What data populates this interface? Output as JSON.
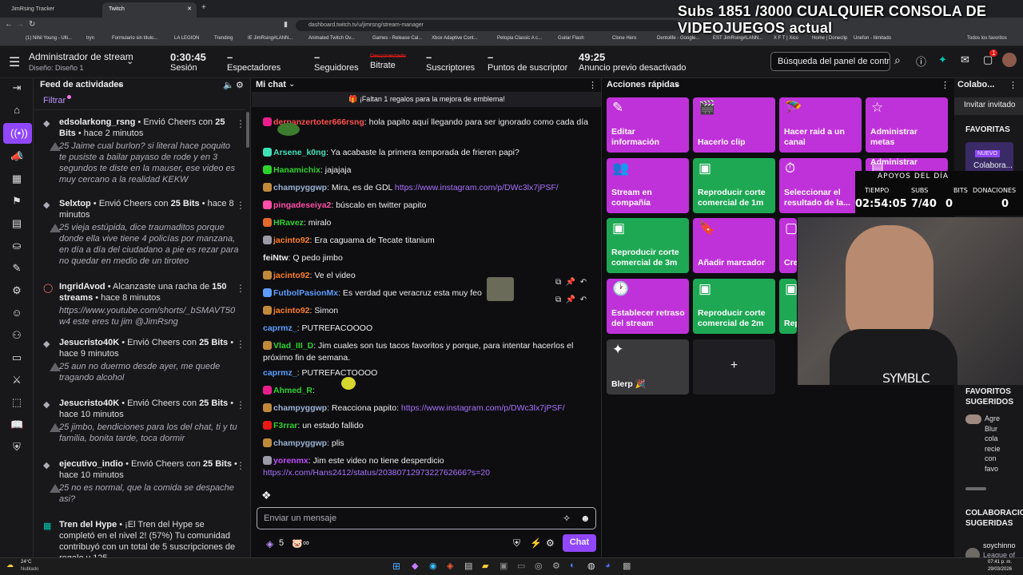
{
  "browser": {
    "tabs": [
      {
        "label": "JimRsing Tracker"
      },
      {
        "label": "Twitch"
      }
    ],
    "new_tab": "+",
    "url": "dashboard.twitch.tv/u/jimrsng/stream-manager",
    "bookmarks": [
      "(1) Nihil Young - Ulti...",
      "tryn",
      "Formulario sin titulo...",
      "LA LEGION",
      "Trending",
      "IE JimRsing#LANN...",
      "Animated Twitch Ov...",
      "Games - Release Cal...",
      "Xbox Adaptive Cont...",
      "Petopia Classic A c...",
      "Guitar Flash",
      "Clone Hero",
      "Dentolife - Google...",
      "EST JimRsing#LANN...",
      "X F T | Xico",
      "Home | Doneclip",
      "Unefon - Ilimitado",
      "Todos los favoritos"
    ]
  },
  "overlay": {
    "title_line1": "Subs 1851 /3000 CUALQUIER CONSOLA DE",
    "title_line2": "VIDEOJUEGOS actual",
    "apoyos_title": "APOYOS DEL DÍA",
    "headers": [
      "TIEMPO",
      "SUBS",
      "BITS",
      "DONACIONES"
    ],
    "values": [
      "02:54:05",
      "7/40",
      "0",
      "0"
    ],
    "logo_text": "SYMBLC"
  },
  "header": {
    "title": "Administrador de stream",
    "subtitle": "Diseño: Diseño 1",
    "session_time": "0:30:45",
    "session_label": "Sesión",
    "viewers_value": "–",
    "viewers_label": "Espectadores",
    "followers_value": "–",
    "followers_label": "Seguidores",
    "bitrate_value": "Desconectado",
    "bitrate_label": "Bitrate",
    "subs_value": "–",
    "subs_label": "Suscriptores",
    "points_value": "–",
    "points_label": "Puntos de suscriptor",
    "ad_time": "49:25",
    "ad_label": "Anuncio previo desactivado",
    "search_placeholder": "Búsqueda del panel de control",
    "notif_count": "1"
  },
  "feed": {
    "title": "Feed de actividades",
    "filter": "Filtrar",
    "items": [
      {
        "user": "edsolarkong_rsng",
        "text": " • Envió Cheers con ",
        "bits": "25 Bits",
        "time": " • hace 2 minutos",
        "msg": "25 Jaime cual burlon? si literal hace poquito te pusiste a bailar payaso de rode y en 3 segundos te diste en la mauser, ese video es muy cercano a la realidad KEKW"
      },
      {
        "user": "Selxtop",
        "text": " • Envió Cheers con ",
        "bits": "25 Bits",
        "time": " • hace 8 minutos",
        "msg": "25 vieja estúpida, dice traumaditos porque donde ella vive tiene 4 policías por manzana, en día a día del ciudadano a pie es rezar para no quedar en medio de un tiroteo"
      },
      {
        "user": "IngridAvod",
        "text": " • Alcanzaste una racha de ",
        "bits": "150 streams",
        "time": " • hace 8 minutos",
        "msg": "https://www.youtube.com/shorts/_bSMAVT50w4 este eres tu jim @JimRsng"
      },
      {
        "user": "Jesucristo40K",
        "text": " • Envió Cheers con ",
        "bits": "25 Bits",
        "time": " • hace 9 minutos",
        "msg": "25 aun no duermo desde ayer, me quede tragando alcohol"
      },
      {
        "user": "Jesucristo40K",
        "text": " • Envió Cheers con ",
        "bits": "25 Bits",
        "time": " • hace 10 minutos",
        "msg": "25 jimbo, bendiciones para los del chat, ti y tu familia, bonita tarde, toca dormir"
      },
      {
        "user": "ejecutivo_indio",
        "text": " • Envió Cheers con ",
        "bits": "25 Bits",
        "time": " • hace 10 minutos",
        "msg": "25 no es normal, que la comida se despache asi?"
      },
      {
        "user": "Tren del Hype",
        "text": " • ¡El Tren del Hype se completó en el nivel 2! (57%) Tu comunidad contribuyó con un total de 5 suscripciones de regalo y 125",
        "bits": "",
        "time": "",
        "msg": ""
      }
    ]
  },
  "chat": {
    "title": "Mi chat",
    "banner": "¡Faltan 1 regalos para la mejora de emblema!",
    "messages": [
      {
        "user": "derpanzertoter666rsng",
        "color": "#ff4f4f",
        "text": ": hola papito aquí llegando para ser ignorado como cada día"
      },
      {
        "user": "Arsene_k0ng",
        "color": "#3ee0b8",
        "text": ": Ya acabaste la primera temporada de frieren papi?"
      },
      {
        "user": "Hanamichix",
        "color": "#2ed12e",
        "text": ": jajajaja"
      },
      {
        "user": "champyggwp",
        "color": "#9bb3d6",
        "text": ": Mira, es de GDL ",
        "link": "https://www.instagram.com/p/DWc3lx7jPSF/"
      },
      {
        "user": "pingadeseiya2",
        "color": "#ff4fa8",
        "text": ": búscalo en twitter papito"
      },
      {
        "user": "HRavez",
        "color": "#2ed12e",
        "text": ": miralo"
      },
      {
        "user": "jacinto92",
        "color": "#ff7f27",
        "text": ": Era caguama de Tecate titanium"
      },
      {
        "user": "feiNtw",
        "color": "#efeff1",
        "text": ": Q pedo jimbo"
      },
      {
        "user": "jacinto92",
        "color": "#ff7f27",
        "text": ": Ve el video"
      },
      {
        "user": "FutbolPasionMx",
        "color": "#5c9eff",
        "text": ": Es verdad que veracruz esta muy feo"
      },
      {
        "user": "jacinto92",
        "color": "#ff7f27",
        "text": ": Simon"
      },
      {
        "user": "caprmz_",
        "color": "#5c9eff",
        "text": ": PUTREFACOOOO"
      },
      {
        "user": "Vlad_III_D",
        "color": "#2ed12e",
        "text": ": Jim cuales son tus tacos favoritos y porque, para intentar hacerlos el próximo fin de semana."
      },
      {
        "user": "caprmz_",
        "color": "#5c9eff",
        "text": ": PUTREFACTOOOO"
      },
      {
        "user": "Ahmed_R",
        "color": "#2ed12e",
        "text": ":"
      },
      {
        "user": "champyggwp",
        "color": "#9bb3d6",
        "text": ": Reacciona papito: ",
        "link": "https://www.instagram.com/p/DWc3lx7jPSF/"
      },
      {
        "user": "F3rrar",
        "color": "#2ed12e",
        "text": ": un estado fallido"
      },
      {
        "user": "champyggwp",
        "color": "#9bb3d6",
        "text": ": plis"
      },
      {
        "user": "yorenmx",
        "color": "#c04bff",
        "text": ": Jim este video no tiene desperdicio",
        "link": "https://x.com/Hans2412/status/2038071297322762666?s=20"
      }
    ],
    "input_placeholder": "Enviar un mensaje",
    "points": "5",
    "infinity": "∞",
    "chat_button": "Chat"
  },
  "quick_actions": {
    "title": "Acciones rápidas",
    "tiles": [
      {
        "label": "Editar información",
        "color": "#bf32d9",
        "icon": "✎"
      },
      {
        "label": "Hacerlo clip",
        "color": "#bf32d9",
        "icon": "🎬"
      },
      {
        "label": "Hacer raid a un canal",
        "color": "#bf32d9",
        "icon": "🪂"
      },
      {
        "label": "Administrar metas",
        "color": "#bf32d9",
        "icon": "☆"
      },
      {
        "label": "Stream en compañía",
        "color": "#bf32d9",
        "icon": "👥"
      },
      {
        "label": "Reproducir corte comercial de 1m",
        "color": "#1ea854",
        "icon": "▣"
      },
      {
        "label": "Seleccionar el resultado de la...",
        "color": "#bf32d9",
        "icon": "⏱"
      },
      {
        "label": "Administrar",
        "color": "#bf32d9",
        "icon": "▤"
      },
      {
        "label": "Reproducir corte comercial de 3m",
        "color": "#1ea854",
        "icon": "▣"
      },
      {
        "label": "Añadir marcador",
        "color": "#bf32d9",
        "icon": "🔖"
      },
      {
        "label": "Crear moderación",
        "color": "#bf32d9",
        "icon": "▢"
      },
      {
        "label": "Establecer retraso del stream",
        "color": "#bf32d9",
        "icon": "🕐"
      },
      {
        "label": "Reproducir corte comercial de 2m",
        "color": "#1ea854",
        "icon": "▣"
      },
      {
        "label": "Reproducir corte",
        "color": "#1ea854",
        "icon": "▣"
      },
      {
        "label": "Blerp 🎉",
        "color": "#3a3a3d",
        "icon": "✦"
      }
    ],
    "add_label": "+"
  },
  "collab": {
    "title": "Colabo...",
    "invite": "Invitar invitado",
    "favorites": "FAVORITAS",
    "new_badge": "NUEVO",
    "collab_text": "Colabora...",
    "suggested_fav": "FAVORITOS SUGERIDOS",
    "suggested_text": [
      "Agre",
      "Blur",
      "cola",
      "recie",
      "con",
      "favo"
    ],
    "collab_suggested": "COLABORACIONES SUGERIDAS",
    "user": "soychinno",
    "user_sub": "League of"
  },
  "taskbar": {
    "weather_temp": "24°C",
    "weather_desc": "Nublado",
    "time": "07:41 p. m.",
    "date": "29/03/2026"
  },
  "colors": {
    "accent": "#a970ff",
    "purple_tile": "#bf32d9",
    "green_tile": "#1ea854"
  }
}
